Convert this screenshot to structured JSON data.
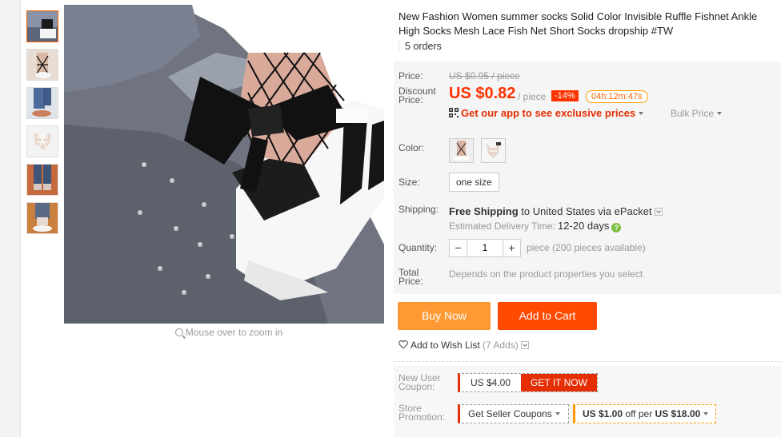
{
  "product": {
    "title": "New Fashion Women summer socks Solid Color Invisible Ruffle Fishnet Ankle High Socks Mesh Lace Fish Net Short Socks dropship #TW",
    "orders": "5 orders"
  },
  "gallery": {
    "thumbnails": [
      "thumb-1",
      "thumb-2",
      "thumb-3",
      "thumb-4",
      "thumb-5",
      "thumb-6"
    ],
    "zoom_hint": "Mouse over to zoom in"
  },
  "pricing": {
    "price_label": "Price:",
    "original_price": "US $0.95 / piece",
    "discount_label_1": "Discount",
    "discount_label_2": "Price:",
    "current_price": "US $0.82",
    "per_unit": "/ piece",
    "discount_badge": "-14%",
    "countdown": "04h:12m:47s",
    "app_promo": "Get our app to see exclusive prices",
    "bulk_price": "Bulk Price"
  },
  "options": {
    "color_label": "Color:",
    "size_label": "Size:",
    "size_value": "one size",
    "shipping_label": "Shipping:",
    "shipping_free": "Free Shipping",
    "shipping_to": "to",
    "shipping_dest": "United States via ePacket",
    "delivery_label": "Estimated Delivery Time:",
    "delivery_value": "12-20 days",
    "quantity_label": "Quantity:",
    "quantity_value": "1",
    "quantity_minus": "−",
    "quantity_plus": "+",
    "quantity_available": "piece (200 pieces available)",
    "total_label_1": "Total",
    "total_label_2": "Price:",
    "total_note": "Depends on the product properties you select"
  },
  "actions": {
    "buy_now": "Buy Now",
    "add_to_cart": "Add to Cart",
    "wishlist": "Add to Wish List",
    "wishlist_count": "(7 Adds)"
  },
  "coupons": {
    "new_user_label_1": "New User",
    "new_user_label_2": "Coupon:",
    "new_user_amount": "US $4.00",
    "get_it_now": "GET IT NOW",
    "store_label_1": "Store",
    "store_label_2": "Promotion:",
    "seller_coupons": "Get Seller Coupons",
    "promo_off": "US $1.00",
    "promo_per": "off per",
    "promo_threshold": "US $18.00"
  },
  "colors": {
    "accent_red": "#f30",
    "buy_orange": "#ff9933",
    "cart_orange": "#ff4a00"
  }
}
